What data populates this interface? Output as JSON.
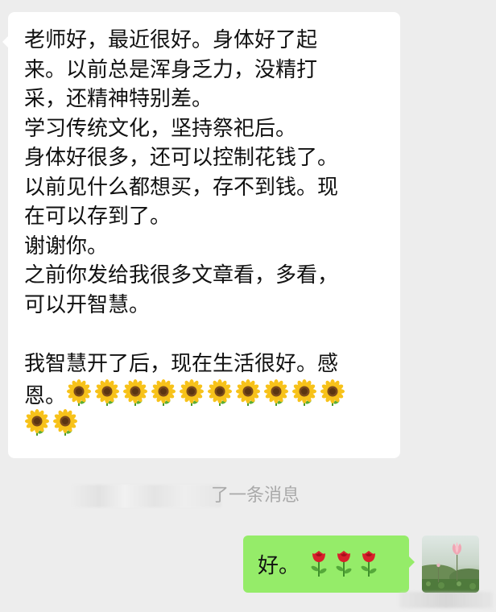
{
  "incoming_message": {
    "lines": [
      "老师好，最近很好。身体好了起",
      "来。以前总是浑身乏力，没精打",
      "采，还精神特别差。",
      "学习传统文化，坚持祭祀后。",
      "身体好很多，还可以控制花钱了。",
      "以前见什么都想买，存不到钱。现",
      "在可以存到了。",
      "谢谢你。",
      "之前你发给我很多文章看，多看，",
      "可以开智慧。",
      "",
      "我智慧开了后，现在生活很好。感",
      "恩。"
    ],
    "emoji_icon": "sunflower-icon",
    "sunflower_count_line1": 10,
    "sunflower_count_line2": 2
  },
  "recall_notice": {
    "text": "了一条消息"
  },
  "outgoing_message": {
    "text": "好。",
    "emoji_icon": "rose-icon",
    "rose_count": 3
  },
  "colors": {
    "background": "#ededed",
    "incoming_bubble": "#ffffff",
    "outgoing_bubble": "#95ec69",
    "notice_text": "#a9a9a9"
  }
}
